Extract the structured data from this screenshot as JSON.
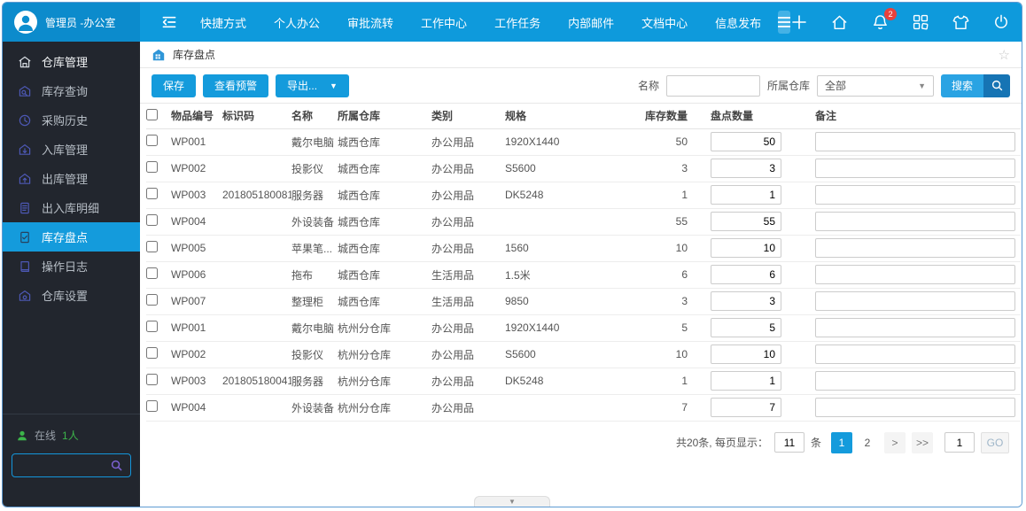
{
  "topbar": {
    "user_name": "管理员 -办公室",
    "nav_items": [
      "快捷方式",
      "个人办公",
      "审批流转",
      "工作中心",
      "工作任务",
      "内部邮件",
      "文档中心",
      "信息发布"
    ],
    "notification_count": "2",
    "right_icons": [
      "plus-icon",
      "home-icon",
      "bell-icon",
      "apps-icon",
      "shirt-icon",
      "power-icon"
    ]
  },
  "sidebar": {
    "items": [
      {
        "label": "仓库管理",
        "icon": "warehouse-home-icon",
        "type": "header"
      },
      {
        "label": "库存查询",
        "icon": "inventory-search-icon"
      },
      {
        "label": "采购历史",
        "icon": "clock-icon"
      },
      {
        "label": "入库管理",
        "icon": "inbound-icon"
      },
      {
        "label": "出库管理",
        "icon": "outbound-icon"
      },
      {
        "label": "出入库明细",
        "icon": "detail-doc-icon"
      },
      {
        "label": "库存盘点",
        "icon": "stocktake-doc-icon",
        "active": true
      },
      {
        "label": "操作日志",
        "icon": "log-icon"
      },
      {
        "label": "仓库设置",
        "icon": "warehouse-settings-icon"
      }
    ],
    "online_label": "在线",
    "online_count": "1人"
  },
  "page": {
    "title": "库存盘点"
  },
  "toolbar": {
    "save": "保存",
    "view_alert": "查看预警",
    "export": "导出...",
    "name_label": "名称",
    "name_value": "",
    "warehouse_label": "所属仓库",
    "warehouse_value": "全部",
    "search": "搜索"
  },
  "table": {
    "headers": {
      "code": "物品编号",
      "tag": "标识码",
      "name": "名称",
      "warehouse": "所属仓库",
      "category": "类别",
      "spec": "规格",
      "stock": "库存数量",
      "count": "盘点数量",
      "note": "备注"
    },
    "rows": [
      {
        "code": "WP001",
        "tag": "",
        "name": "戴尔电脑",
        "warehouse": "城西仓库",
        "category": "办公用品",
        "spec": "1920X1440",
        "stock": "50",
        "count": "50",
        "note": ""
      },
      {
        "code": "WP002",
        "tag": "",
        "name": "投影仪",
        "warehouse": "城西仓库",
        "category": "办公用品",
        "spec": "S5600",
        "stock": "3",
        "count": "3",
        "note": ""
      },
      {
        "code": "WP003",
        "tag": "201805180081",
        "name": "服务器",
        "warehouse": "城西仓库",
        "category": "办公用品",
        "spec": "DK5248",
        "stock": "1",
        "count": "1",
        "note": ""
      },
      {
        "code": "WP004",
        "tag": "",
        "name": "外设装备",
        "warehouse": "城西仓库",
        "category": "办公用品",
        "spec": "",
        "stock": "55",
        "count": "55",
        "note": ""
      },
      {
        "code": "WP005",
        "tag": "",
        "name": "苹果笔...",
        "warehouse": "城西仓库",
        "category": "办公用品",
        "spec": "1560",
        "stock": "10",
        "count": "10",
        "note": ""
      },
      {
        "code": "WP006",
        "tag": "",
        "name": "拖布",
        "warehouse": "城西仓库",
        "category": "生活用品",
        "spec": "1.5米",
        "stock": "6",
        "count": "6",
        "note": ""
      },
      {
        "code": "WP007",
        "tag": "",
        "name": "整理柜",
        "warehouse": "城西仓库",
        "category": "生活用品",
        "spec": "9850",
        "stock": "3",
        "count": "3",
        "note": ""
      },
      {
        "code": "WP001",
        "tag": "",
        "name": "戴尔电脑",
        "warehouse": "杭州分仓库",
        "category": "办公用品",
        "spec": "1920X1440",
        "stock": "5",
        "count": "5",
        "note": ""
      },
      {
        "code": "WP002",
        "tag": "",
        "name": "投影仪",
        "warehouse": "杭州分仓库",
        "category": "办公用品",
        "spec": "S5600",
        "stock": "10",
        "count": "10",
        "note": ""
      },
      {
        "code": "WP003",
        "tag": "201805180041",
        "name": "服务器",
        "warehouse": "杭州分仓库",
        "category": "办公用品",
        "spec": "DK5248",
        "stock": "1",
        "count": "1",
        "note": ""
      },
      {
        "code": "WP004",
        "tag": "",
        "name": "外设装备",
        "warehouse": "杭州分仓库",
        "category": "办公用品",
        "spec": "",
        "stock": "7",
        "count": "7",
        "note": ""
      }
    ]
  },
  "pagination": {
    "summary": "共20条, 每页显示：",
    "page_size": "11",
    "unit": "条",
    "pages": [
      "1",
      "2"
    ],
    "active_page": "1",
    "next": ">",
    "last": ">>",
    "goto_value": "1",
    "go_label": "GO"
  },
  "colors": {
    "topbar_blue": "#0e9adc",
    "user_area_blue": "#0c8bcc",
    "sidebar_bg": "#22262e",
    "active_blue": "#149bdc",
    "badge_red": "#e8413c",
    "online_green": "#3cb54a"
  }
}
